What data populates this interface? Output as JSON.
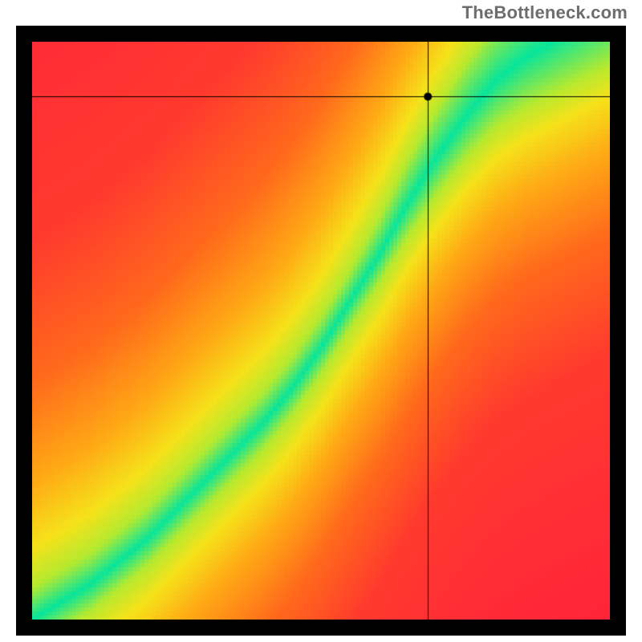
{
  "watermark": "TheBottleneck.com",
  "chart_data": {
    "type": "heatmap",
    "title": "",
    "xlabel": "",
    "ylabel": "",
    "xlim": [
      0,
      1
    ],
    "ylim": [
      0,
      1
    ],
    "grid": false,
    "legend": false,
    "marker": {
      "x": 0.685,
      "y": 0.905
    },
    "crosshair": {
      "x": 0.685,
      "y": 0.905
    },
    "ridge": {
      "description": "Curve along which the heatmap value is optimal (green band). Approximate piecewise points (x: horizontal fraction left→right, y: vertical fraction bottom→top).",
      "points": [
        {
          "x": 0.0,
          "y": 0.0
        },
        {
          "x": 0.1,
          "y": 0.06
        },
        {
          "x": 0.2,
          "y": 0.14
        },
        {
          "x": 0.3,
          "y": 0.24
        },
        {
          "x": 0.4,
          "y": 0.34
        },
        {
          "x": 0.45,
          "y": 0.4
        },
        {
          "x": 0.5,
          "y": 0.47
        },
        {
          "x": 0.55,
          "y": 0.55
        },
        {
          "x": 0.6,
          "y": 0.63
        },
        {
          "x": 0.65,
          "y": 0.72
        },
        {
          "x": 0.7,
          "y": 0.8
        },
        {
          "x": 0.75,
          "y": 0.87
        },
        {
          "x": 0.8,
          "y": 0.93
        },
        {
          "x": 0.85,
          "y": 0.97
        },
        {
          "x": 0.9,
          "y": 1.0
        }
      ],
      "half_width_frac": 0.045
    },
    "colormap": {
      "description": "distance-to-ridge → color. 0 = on ridge. Stops are distance thresholds in normalized units.",
      "stops": [
        {
          "d": 0.0,
          "color": "#07e59c"
        },
        {
          "d": 0.06,
          "color": "#b7ea2f"
        },
        {
          "d": 0.12,
          "color": "#f6e21a"
        },
        {
          "d": 0.22,
          "color": "#ffab15"
        },
        {
          "d": 0.38,
          "color": "#ff6a1c"
        },
        {
          "d": 0.6,
          "color": "#ff3a2e"
        },
        {
          "d": 1.2,
          "color": "#ff1f3d"
        }
      ],
      "corner_yellow": {
        "x": 1.0,
        "y": 0.0,
        "color": "#ffe940",
        "radius": 0.55
      }
    }
  }
}
